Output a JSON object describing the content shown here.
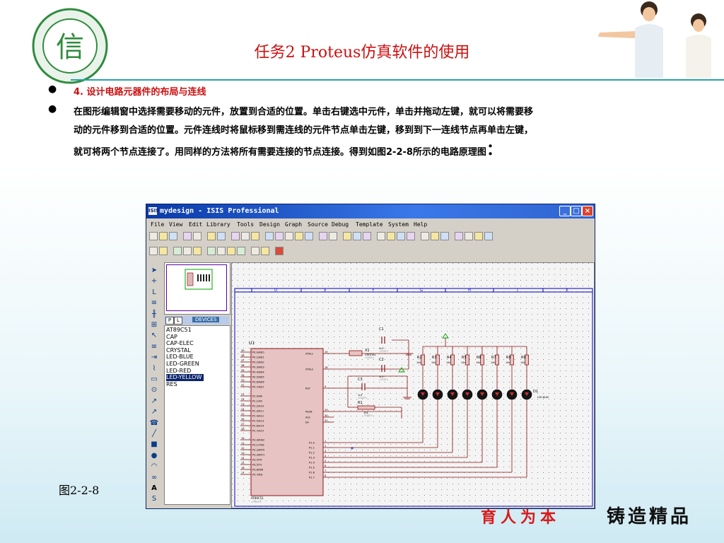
{
  "slide": {
    "title": "任务2   Proteus仿真软件的使用",
    "bullet1": "4. 设计电路元器件的布局与连线",
    "bullet2_line1": "在图形编辑窗中选择需要移动的元件，放置到合适的位置。单击右键选中元件，单击并拖动左键，就可以将需要移",
    "bullet2_line2": "动的元件移到合适的位置。元件连线时将鼠标移到需连线的元件节点单击左键，移到到下一连线节点再单击左键，",
    "bullet2_line3": "就可将两个节点连接了。用同样的方法将所有需要连接的节点连接。得到如图2-2-8所示的电路原理图",
    "colon": "：",
    "caption": "图2-2-8",
    "slogan_red": "育人为本",
    "slogan_black": "铸造精品",
    "colors": {
      "title": "#cc1010",
      "accent": "#2aa1a8",
      "slogan_red": "#d91a1a"
    }
  },
  "window": {
    "title": "mydesign - ISIS Professional",
    "menu": [
      "File",
      "View",
      "Edit",
      "Library",
      "Tools",
      "Design",
      "Graph",
      "Source",
      "Debug",
      "Template",
      "System",
      "Help"
    ],
    "device_panel": {
      "P": "P",
      "L": "L",
      "label": "DEVICES"
    },
    "devices": [
      "AT89C51",
      "CAP",
      "CAP-ELEC",
      "CRYSTAL",
      "LED-BLUE",
      "LED-GREEN",
      "LED-RED",
      "LED-YELLOW",
      "RES"
    ],
    "selected_device": "LED-YELLOW",
    "columns": [
      "D",
      "E",
      "F",
      "G",
      "H",
      "J",
      "K"
    ],
    "schematic": {
      "u1_ref": "U1",
      "u1_part": "AT89C51",
      "u1_text": "<TEXT>",
      "left_pins": [
        [
          "39",
          "P0.0/AD0"
        ],
        [
          "38",
          "P0.1/AD1"
        ],
        [
          "37",
          "P0.2/AD2"
        ],
        [
          "36",
          "P0.3/AD3"
        ],
        [
          "35",
          "P0.4/AD4"
        ],
        [
          "34",
          "P0.5/AD5"
        ],
        [
          "33",
          "P0.6/AD6"
        ],
        [
          "32",
          "P0.7/AD7"
        ],
        [
          "21",
          "P2.0/A8"
        ],
        [
          "22",
          "P2.1/A9"
        ],
        [
          "23",
          "P2.2/A10"
        ],
        [
          "24",
          "P2.3/A11"
        ],
        [
          "25",
          "P2.4/A12"
        ],
        [
          "26",
          "P2.5/A13"
        ],
        [
          "27",
          "P2.6/A14"
        ],
        [
          "28",
          "P2.7/A15"
        ],
        [
          "10",
          "P3.0/RXD"
        ],
        [
          "11",
          "P3.1/TXD"
        ],
        [
          "12",
          "P3.2/INT0"
        ],
        [
          "13",
          "P3.3/INT1"
        ],
        [
          "14",
          "P3.4/T0"
        ],
        [
          "15",
          "P3.5/T1"
        ],
        [
          "16",
          "P3.6/WR"
        ],
        [
          "17",
          "P3.7/RD"
        ]
      ],
      "right_pins_top": [
        [
          "19",
          "XTAL1"
        ],
        [
          "18",
          "XTAL2"
        ],
        [
          "9",
          "RST"
        ],
        [
          "29",
          "PSEN"
        ],
        [
          "30",
          "ALE"
        ],
        [
          "31",
          "EA"
        ]
      ],
      "right_pins_p1": [
        [
          "1",
          "P1.0"
        ],
        [
          "2",
          "P1.1"
        ],
        [
          "3",
          "P1.2"
        ],
        [
          "4",
          "P1.3"
        ],
        [
          "5",
          "P1.4"
        ],
        [
          "6",
          "P1.5"
        ],
        [
          "7",
          "P1.6"
        ],
        [
          "8",
          "P1.7"
        ]
      ],
      "c1": {
        "ref": "C1",
        "val": "1nF",
        "text": "<TEXT>"
      },
      "c2": {
        "ref": "C2",
        "val": "1nF",
        "text": "<TEXT>"
      },
      "c3": {
        "ref": "C3",
        "val": "1nF",
        "text": "<TEXT>"
      },
      "x1": {
        "ref": "X1",
        "val": "CRYSTAL",
        "text": "<TEXT>"
      },
      "r1": {
        "ref": "R1",
        "val": "10k",
        "text": "<TEXT>"
      },
      "resistors": [
        "R2",
        "R3",
        "R4",
        "R5",
        "R6",
        "R7",
        "R8",
        "R9"
      ],
      "res_val": "10k",
      "d1": {
        "ref": "D1",
        "val": "LED-BLUE"
      }
    }
  }
}
